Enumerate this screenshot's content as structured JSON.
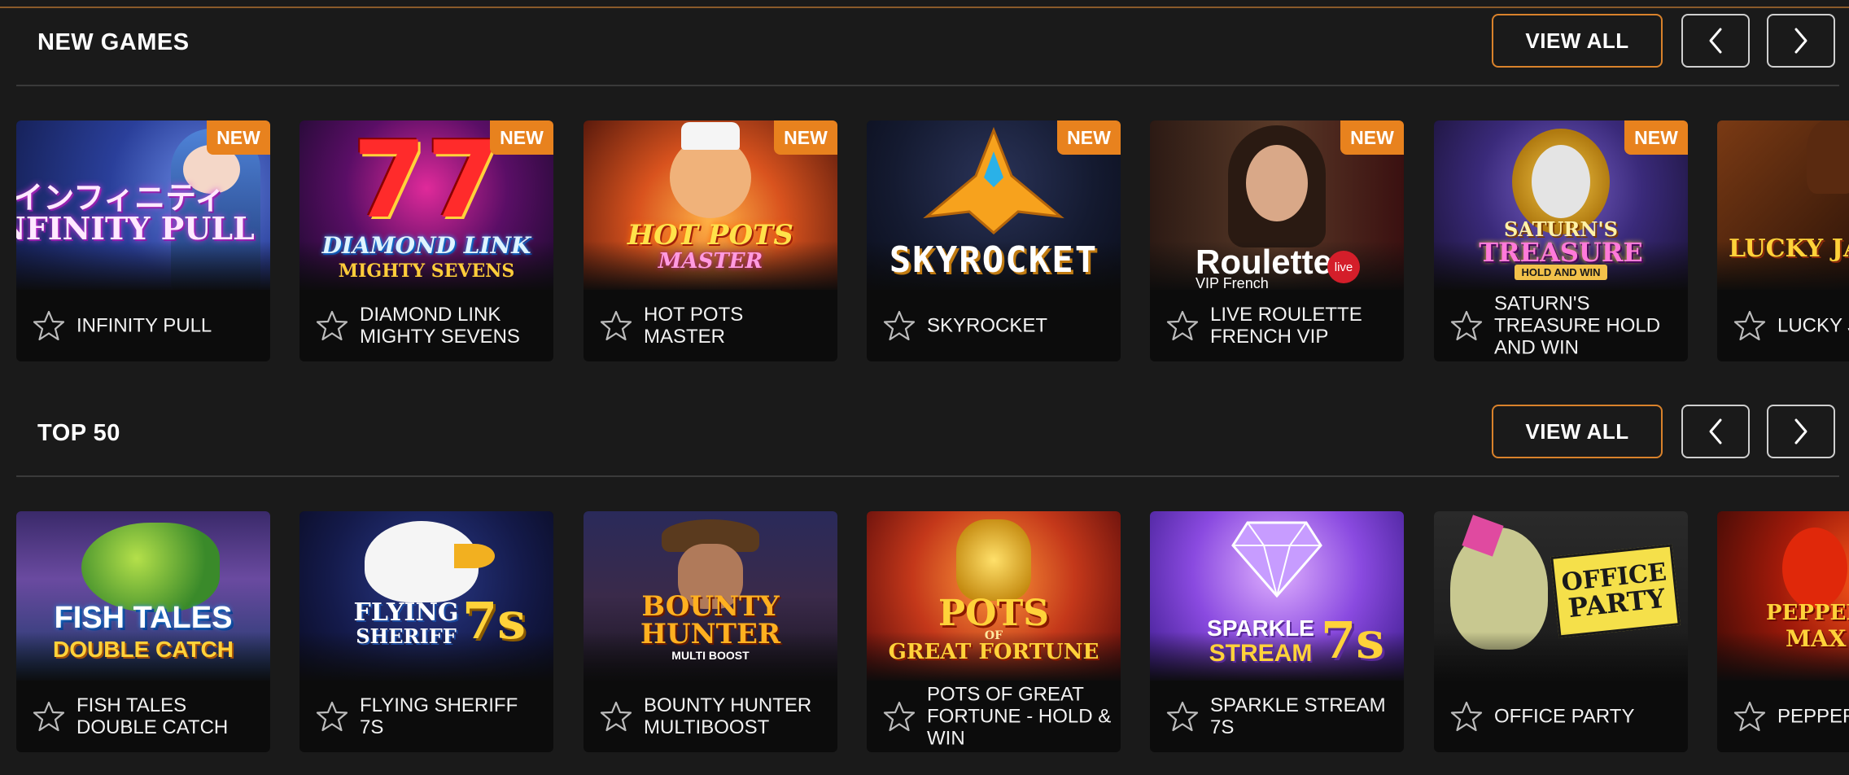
{
  "colors": {
    "background": "#1a1a1a",
    "accent": "#e8821e",
    "card": "#0c0c0c"
  },
  "sections": [
    {
      "title": "NEW GAMES",
      "view_all_label": "VIEW ALL",
      "games": [
        {
          "name": "INFINITY PULL",
          "badge": "NEW",
          "art": "インフィニティ INFINITY PULL"
        },
        {
          "name": "DIAMOND LINK MIGHTY SEVENS",
          "badge": "NEW",
          "art_big": "77",
          "art": "DIAMOND LINK",
          "art_sub": "MIGHTY SEVENS"
        },
        {
          "name": "HOT POTS MASTER",
          "badge": "NEW",
          "art": "HOT POTS",
          "art_sub": "MASTER"
        },
        {
          "name": "SKYROCKET",
          "badge": "NEW",
          "art": "SKYROCKET"
        },
        {
          "name": "LIVE ROULETTE FRENCH VIP",
          "badge": "NEW",
          "art": "Roulette",
          "art_live": "live",
          "art_sub": "VIP French"
        },
        {
          "name": "SATURN'S TREASURE HOLD AND WIN",
          "badge": "NEW",
          "art": "SATURN'S",
          "art_mid": "TREASURE",
          "art_sub": "HOLD AND WIN"
        },
        {
          "name": "LUCKY JANE IN EGYPT",
          "badge": "",
          "art": "LUCKY JANE"
        }
      ]
    },
    {
      "title": "TOP 50",
      "view_all_label": "VIEW ALL",
      "games": [
        {
          "name": "FISH TALES DOUBLE CATCH",
          "art": "FISH TALES",
          "art_sub": "DOUBLE CATCH"
        },
        {
          "name": "FLYING SHERIFF 7S",
          "art": "FLYING",
          "art_mid": "SHERIFF",
          "art_big": "7s"
        },
        {
          "name": "BOUNTY HUNTER MULTIBOOST",
          "art": "BOUNTY",
          "art_mid": "HUNTER",
          "art_sub": "MULTI BOOST"
        },
        {
          "name": "POTS OF GREAT FORTUNE - HOLD & WIN",
          "art": "POTS",
          "art_mid": "OF",
          "art_sub": "GREAT FORTUNE"
        },
        {
          "name": "SPARKLE STREAM 7S",
          "art": "SPARKLE",
          "art_mid": "STREAM",
          "art_big": "7s"
        },
        {
          "name": "OFFICE PARTY",
          "art": "OFFICE",
          "art_sub": "PARTY"
        },
        {
          "name": "PEPPER MAX HOLD & WIN",
          "art": "PEPPER",
          "art_sub": "MAX"
        }
      ]
    }
  ]
}
